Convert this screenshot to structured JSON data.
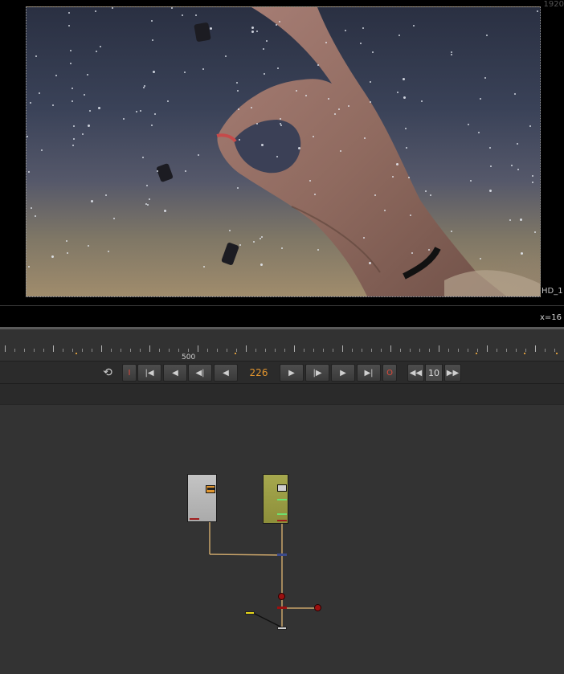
{
  "viewer": {
    "resolution_label": "1920",
    "format_label": "HD_1",
    "coord_readout": "x=16"
  },
  "timeline": {
    "ruler_label": "500"
  },
  "transport": {
    "loop_icon": "loop-icon",
    "in_point_label": "I",
    "first_frame_icon": "skip-to-start-icon",
    "prev_keyframe_icon": "prev-keyframe-icon",
    "prev_frame_icon": "step-back-icon",
    "play_backward_icon": "play-backward-icon",
    "current_frame": "226",
    "play_forward_icon": "play-forward-icon",
    "next_frame_icon": "step-forward-icon",
    "next_keyframe_icon": "next-keyframe-icon",
    "last_frame_icon": "skip-to-end-icon",
    "out_point_label": "O",
    "rewind_icon": "rewind-icon",
    "step_increment": "10",
    "fast_forward_icon": "fast-forward-icon"
  },
  "colors": {
    "accent_frame": "#e4962e",
    "in_out_red": "#e04a3a",
    "read_node": "#bdbdbd",
    "grade_node": "#a0a246",
    "wire": "#c9a46a"
  }
}
